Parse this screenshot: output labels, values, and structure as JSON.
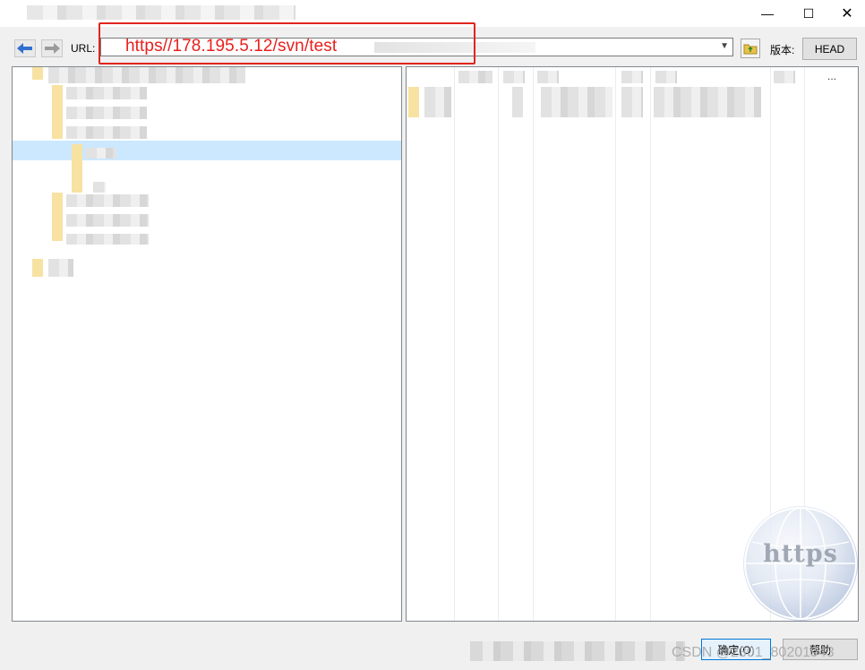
{
  "window": {
    "minimize_glyph": "—",
    "maximize_glyph": "☐",
    "close_glyph": "✕"
  },
  "toolbar": {
    "back_icon": "back-arrow-icon",
    "forward_icon": "forward-arrow-icon",
    "url_label": "URL:",
    "url_value": "https//178.195.5.12/svn/test",
    "browse_icon": "folder-up-icon",
    "revision_label": "版本:",
    "revision_button": "HEAD"
  },
  "list": {
    "overflow_marker": "..."
  },
  "badge": {
    "text": "https"
  },
  "footer": {
    "ok_label": "确定(O)",
    "help_label": "帮助",
    "watermark": "CSDN @2301_80201943"
  },
  "colors": {
    "annotation_red": "#e0251d",
    "selection_blue": "#cce8ff",
    "folder_yellow": "#f7e2a2"
  }
}
